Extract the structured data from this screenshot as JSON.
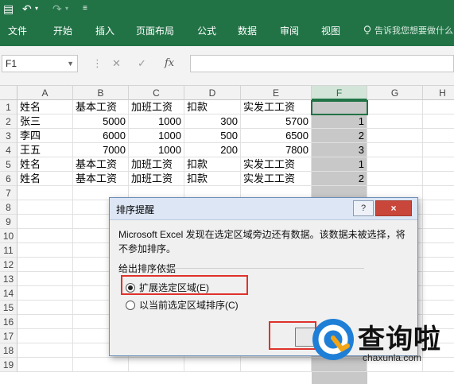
{
  "ribbon": {
    "tabs": [
      "文件",
      "开始",
      "插入",
      "页面布局",
      "公式",
      "数据",
      "审阅",
      "视图"
    ],
    "tell_me": "告诉我您想要做什么"
  },
  "formula_bar": {
    "name_box": "F1",
    "fx_label": "fx"
  },
  "grid": {
    "columns": [
      "A",
      "B",
      "C",
      "D",
      "E",
      "F",
      "G",
      "H"
    ],
    "rows": [
      "1",
      "2",
      "3",
      "4",
      "5",
      "6",
      "7",
      "8",
      "9",
      "10",
      "11",
      "12",
      "13",
      "14",
      "15",
      "16",
      "17",
      "18",
      "19"
    ],
    "cells": [
      [
        "姓名",
        "基本工资",
        "加班工资",
        "扣款",
        "实发工工资",
        ""
      ],
      [
        "张三",
        "5000",
        "1000",
        "300",
        "5700",
        "1"
      ],
      [
        "李四",
        "6000",
        "1000",
        "500",
        "6500",
        "2"
      ],
      [
        "王五",
        "7000",
        "1000",
        "200",
        "7800",
        "3"
      ],
      [
        "姓名",
        "基本工资",
        "加班工资",
        "扣款",
        "实发工工资",
        "1"
      ],
      [
        "姓名",
        "基本工资",
        "加班工资",
        "扣款",
        "实发工工资",
        "2"
      ]
    ]
  },
  "dialog": {
    "title": "排序提醒",
    "help": "?",
    "close": "×",
    "message": "Microsoft Excel 发现在选定区域旁边还有数据。该数据未被选择，将不参加排序。",
    "group_label": "给出排序依据",
    "option_expand": "扩展选定区域(E)",
    "option_current": "以当前选定区域排序(C)",
    "sort_button": "排序"
  },
  "watermark": {
    "name": "查询啦",
    "domain": "chaxunla.com"
  },
  "colors": {
    "ribbon": "#217346",
    "highlight": "#e0322b",
    "watermark_blue": "#1f7fd6"
  }
}
